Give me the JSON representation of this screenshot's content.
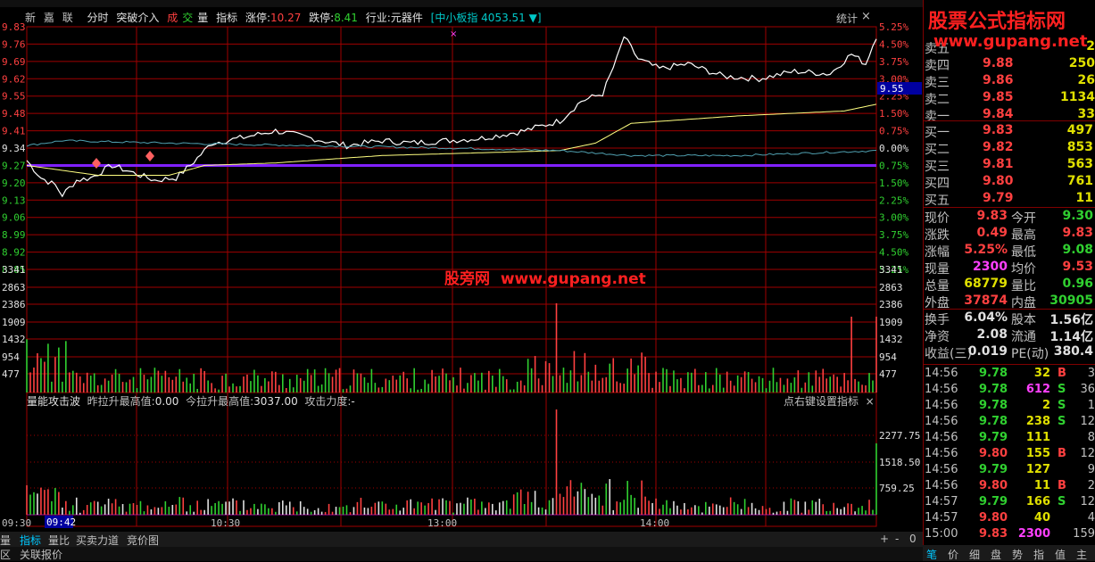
{
  "header": {
    "stock": [
      "新",
      "嘉",
      "联"
    ],
    "mode": "分时",
    "indicator_name": "突破介入",
    "vol_a": "成",
    "vol_b": "交",
    "vol_c": "量",
    "indicator_label": "指标",
    "limit_up_label": "涨停:",
    "limit_up": "10.27",
    "limit_down_label": "跌停:",
    "limit_down": "8.41",
    "industry_label": "行业:",
    "industry": "元器件",
    "index_label": "[中小板指",
    "index_value": "4053.51",
    "index_arrow": "▼]",
    "stat_button": "统计",
    "close_icon": "×"
  },
  "price_axis_left": [
    "9.83",
    "9.76",
    "9.69",
    "9.62",
    "9.55",
    "9.48",
    "9.41",
    "9.34",
    "9.27",
    "9.20",
    "9.13",
    "9.06",
    "8.99",
    "8.92",
    "8.85"
  ],
  "pct_axis_right": [
    "5.25%",
    "4.50%",
    "3.75%",
    "3.00%",
    "2.25%",
    "1.50%",
    "0.75%",
    "0.00%",
    "0.75%",
    "1.50%",
    "2.25%",
    "3.00%",
    "3.75%",
    "4.50%",
    "5.25%"
  ],
  "vol_axis_left": [
    "3341",
    "2863",
    "2386",
    "1909",
    "1432",
    "954",
    "477"
  ],
  "vol_axis_right": [
    "3341",
    "2863",
    "2386",
    "1909",
    "1432",
    "954",
    "477"
  ],
  "cursor_price": "9.55",
  "watermark": {
    "cn": "股旁网",
    "url": "www.gupang.net"
  },
  "logo": {
    "title": "股票公式指标网",
    "url": "www.gupang.net"
  },
  "sub_indicator": {
    "name": "量能攻击波",
    "prev_high_label": "昨拉升最高值:",
    "prev_high": "0.00",
    "today_high_label": "今拉升最高值:",
    "today_high": "3037.00",
    "power_label": "攻击力度:",
    "power": "-",
    "right_hint": "点右键设置指标",
    "close_icon": "×",
    "axis": [
      "2277.75",
      "1518.50",
      "759.25"
    ]
  },
  "time_axis": {
    "start": "09:30",
    "cursor": "09:42",
    "t1": "10:30",
    "t2": "13:00",
    "t3": "14:00"
  },
  "bottom_tabs": [
    "量",
    "指标",
    "量比",
    "买卖力道",
    "竞价图"
  ],
  "bottom_tabs2": [
    "区",
    "关联报价"
  ],
  "zoom_controls": [
    "+",
    "-",
    "0"
  ],
  "order_book": {
    "asks": [
      {
        "label": "卖五",
        "price": "",
        "vol": "2"
      },
      {
        "label": "卖四",
        "price": "9.88",
        "vol": "250"
      },
      {
        "label": "卖三",
        "price": "9.86",
        "vol": "26"
      },
      {
        "label": "卖二",
        "price": "9.85",
        "vol": "1134"
      },
      {
        "label": "卖一",
        "price": "9.84",
        "vol": "33"
      }
    ],
    "bids": [
      {
        "label": "买一",
        "price": "9.83",
        "vol": "497"
      },
      {
        "label": "买二",
        "price": "9.82",
        "vol": "853"
      },
      {
        "label": "买三",
        "price": "9.81",
        "vol": "563"
      },
      {
        "label": "买四",
        "price": "9.80",
        "vol": "761"
      },
      {
        "label": "买五",
        "price": "9.79",
        "vol": "11"
      }
    ]
  },
  "stats": [
    {
      "l1": "现价",
      "v1": "9.83",
      "c1": "#ff4040",
      "l2": "今开",
      "v2": "9.30",
      "c2": "#30d030"
    },
    {
      "l1": "涨跌",
      "v1": "0.49",
      "c1": "#ff4040",
      "l2": "最高",
      "v2": "9.83",
      "c2": "#ff4040"
    },
    {
      "l1": "涨幅",
      "v1": "5.25%",
      "c1": "#ff4040",
      "l2": "最低",
      "v2": "9.08",
      "c2": "#30d030"
    },
    {
      "l1": "现量",
      "v1": "2300",
      "c1": "#ff40ff",
      "l2": "均价",
      "v2": "9.53",
      "c2": "#ff4040"
    },
    {
      "l1": "总量",
      "v1": "68779",
      "c1": "#e0e000",
      "l2": "量比",
      "v2": "0.96",
      "c2": "#30d030"
    },
    {
      "l1": "外盘",
      "v1": "37874",
      "c1": "#ff4040",
      "l2": "内盘",
      "v2": "30905",
      "c2": "#30d030"
    },
    {
      "l1": "换手",
      "v1": "6.04%",
      "c1": "#e0e0e0",
      "l2": "股本",
      "v2": "1.56亿",
      "c2": "#e0e0e0"
    },
    {
      "l1": "净资",
      "v1": "2.08",
      "c1": "#e0e0e0",
      "l2": "流通",
      "v2": "1.14亿",
      "c2": "#e0e0e0"
    },
    {
      "l1": "收益(三)",
      "v1": "0.019",
      "c1": "#e0e0e0",
      "l2": "PE(动)",
      "v2": "380.4",
      "c2": "#e0e0e0"
    }
  ],
  "ticks": [
    {
      "t": "14:56",
      "p": "9.78",
      "pc": "#30d030",
      "v": "32",
      "vc": "#e0e000",
      "bs": "B",
      "bsc": "#ff4040",
      "n": "3"
    },
    {
      "t": "14:56",
      "p": "9.78",
      "pc": "#30d030",
      "v": "612",
      "vc": "#ff40ff",
      "bs": "S",
      "bsc": "#30d030",
      "n": "36"
    },
    {
      "t": "14:56",
      "p": "9.78",
      "pc": "#30d030",
      "v": "2",
      "vc": "#e0e000",
      "bs": "S",
      "bsc": "#30d030",
      "n": "1"
    },
    {
      "t": "14:56",
      "p": "9.78",
      "pc": "#30d030",
      "v": "238",
      "vc": "#e0e000",
      "bs": "S",
      "bsc": "#30d030",
      "n": "12"
    },
    {
      "t": "14:56",
      "p": "9.79",
      "pc": "#30d030",
      "v": "111",
      "vc": "#e0e000",
      "bs": "",
      "bsc": "#ff4040",
      "n": "8"
    },
    {
      "t": "14:56",
      "p": "9.80",
      "pc": "#ff4040",
      "v": "155",
      "vc": "#e0e000",
      "bs": "B",
      "bsc": "#ff4040",
      "n": "12"
    },
    {
      "t": "14:56",
      "p": "9.79",
      "pc": "#30d030",
      "v": "127",
      "vc": "#e0e000",
      "bs": "",
      "bsc": "#30d030",
      "n": "9"
    },
    {
      "t": "14:56",
      "p": "9.80",
      "pc": "#ff4040",
      "v": "11",
      "vc": "#e0e000",
      "bs": "B",
      "bsc": "#ff4040",
      "n": "2"
    },
    {
      "t": "14:57",
      "p": "9.79",
      "pc": "#30d030",
      "v": "166",
      "vc": "#e0e000",
      "bs": "S",
      "bsc": "#30d030",
      "n": "12"
    },
    {
      "t": "14:57",
      "p": "9.80",
      "pc": "#ff4040",
      "v": "40",
      "vc": "#e0e000",
      "bs": "",
      "bsc": "#ff4040",
      "n": "4"
    },
    {
      "t": "15:00",
      "p": "9.83",
      "pc": "#ff4040",
      "v": "2300",
      "vc": "#ff40ff",
      "bs": "",
      "bsc": "#ff4040",
      "n": "159"
    }
  ],
  "quote_tabs": [
    "笔",
    "价",
    "细",
    "盘",
    "势",
    "指",
    "值",
    "主"
  ],
  "colors": {
    "grid": "#a00000",
    "price_line": "#ffffff",
    "avg_line": "#ffff80",
    "index_line": "#50a0b0",
    "prev_close": "#8020ff",
    "up": "#ff4040",
    "down": "#30d030"
  }
}
